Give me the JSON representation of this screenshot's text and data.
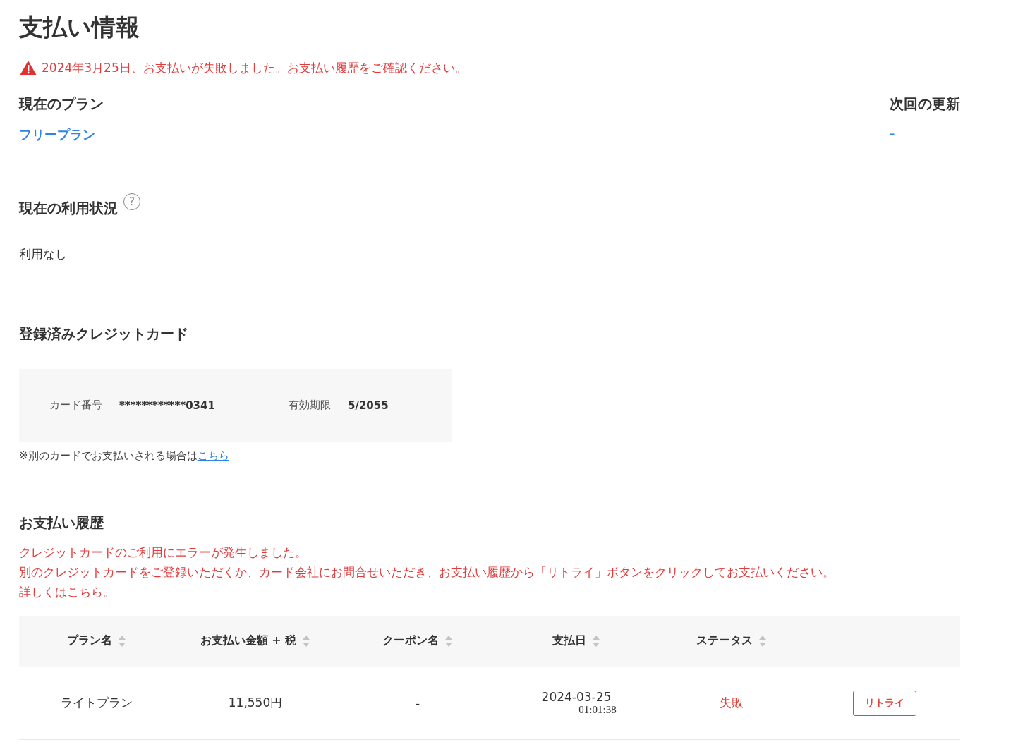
{
  "page_title": "支払い情報",
  "alert": {
    "text": "2024年3月25日、お支払いが失敗しました。お支払い履歴をご確認ください。"
  },
  "current_plan": {
    "label": "現在のプラン",
    "value": "フリープラン"
  },
  "next_renewal": {
    "label": "次回の更新",
    "value": "-"
  },
  "usage": {
    "heading": "現在の利用状況",
    "help_icon": "?",
    "value": "利用なし"
  },
  "credit_card": {
    "heading": "登録済みクレジットカード",
    "number_label": "カード番号",
    "number": "************0341",
    "expiry_label": "有効期限",
    "expiry": "5/2055",
    "note": "※別のカードでお支払いされる場合は",
    "note_link": "こちら"
  },
  "payment_history": {
    "heading": "お支払い履歴",
    "message_lines": [
      "クレジットカードのご利用にエラーが発生しました。",
      "別のクレジットカードをご登録いただくか、カード会社にお問合せいただき、お支払い履歴から「リトライ」ボタンをクリックしてお支払いください。"
    ],
    "details_before": "詳しくは",
    "details_link": "こちら",
    "details_after": "。",
    "columns": [
      "プラン名",
      "お支払い金額 + 税",
      "クーポン名",
      "支払日",
      "ステータス"
    ],
    "rows": [
      {
        "plan": "ライトプラン",
        "amount": "11,550円",
        "coupon": "-",
        "date": "2024-03-25",
        "time": "01:01:38",
        "status": "失敗",
        "failed": true,
        "action": "リトライ"
      }
    ]
  }
}
